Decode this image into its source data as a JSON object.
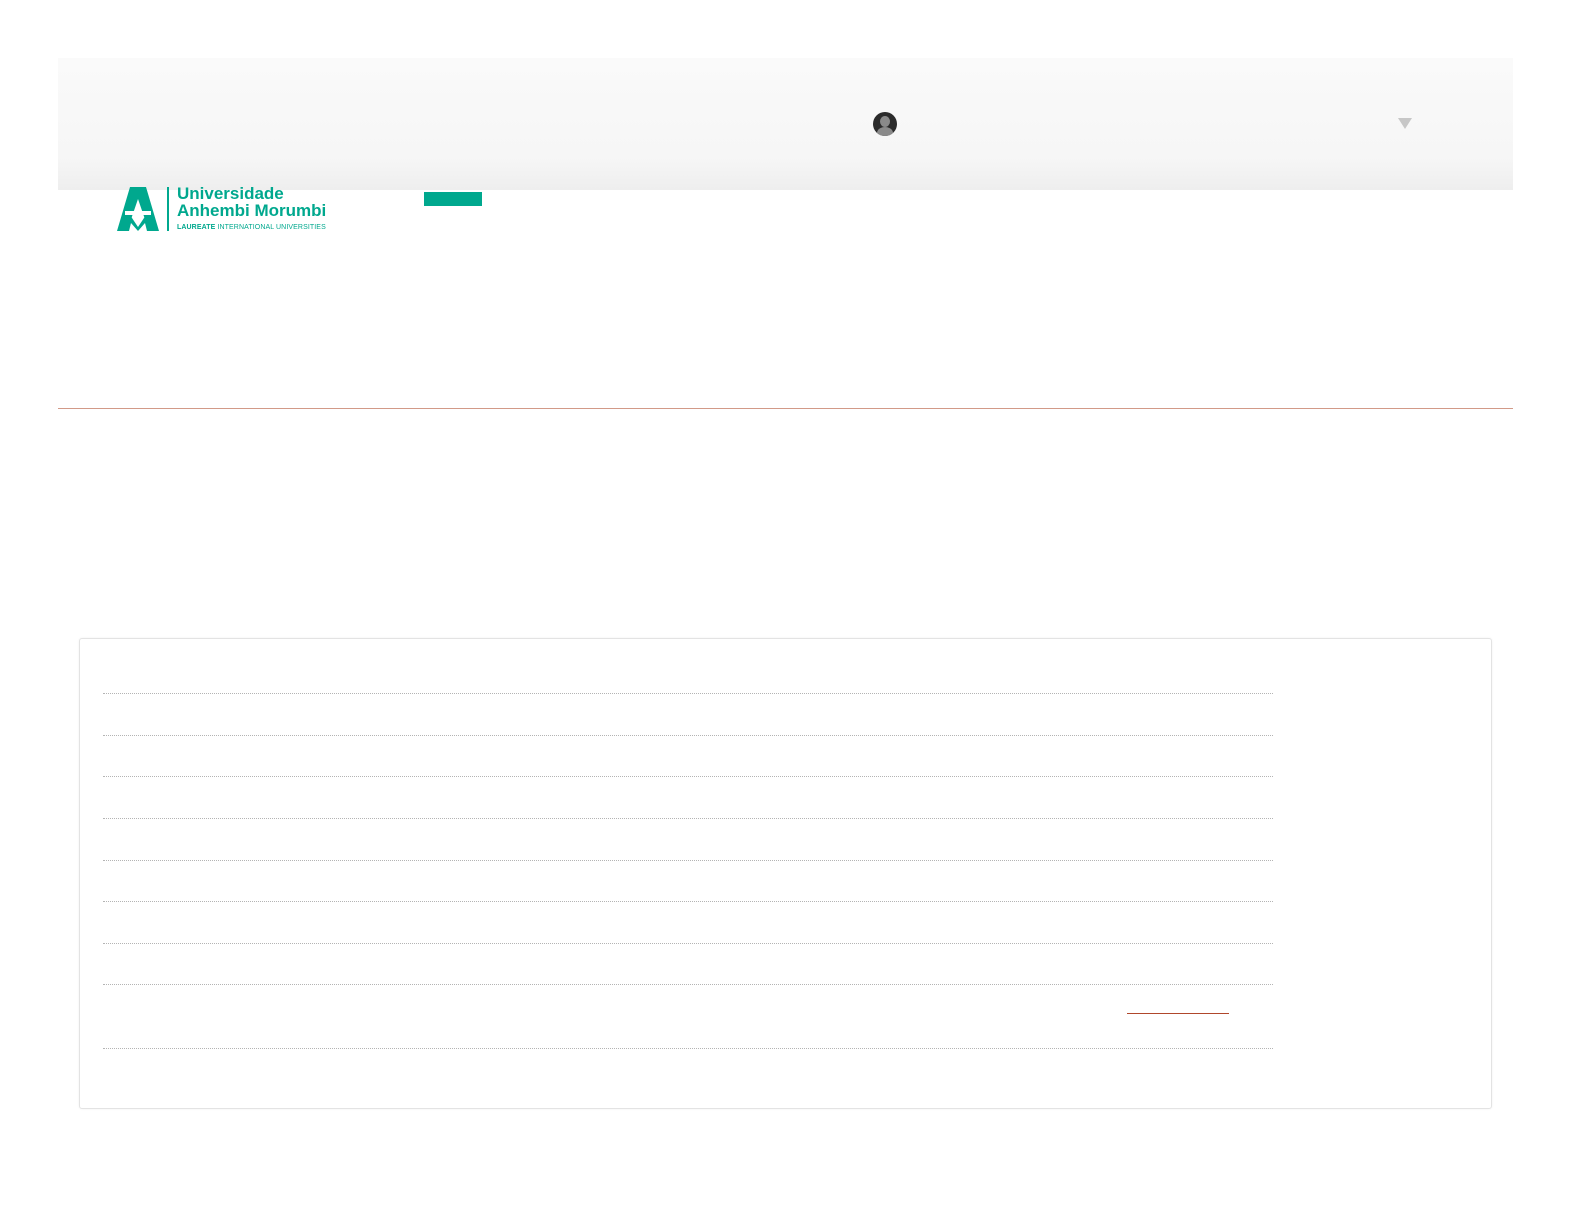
{
  "header": {
    "user_name": "",
    "avatar_icon": "user-avatar-icon",
    "dropdown_icon": "caret-down-icon"
  },
  "logo": {
    "line1": "Universidade",
    "line2": "Anhembi Morumbi",
    "tagline_bold": "LAUREATE",
    "tagline_rest": " INTERNATIONAL UNIVERSITIES"
  },
  "colors": {
    "brand": "#00a88e",
    "rule": "#d29a88",
    "link": "#b0472c"
  },
  "card": {
    "rows": [
      "",
      "",
      "",
      "",
      "",
      "",
      "",
      "",
      "",
      ""
    ],
    "link_text": ""
  }
}
